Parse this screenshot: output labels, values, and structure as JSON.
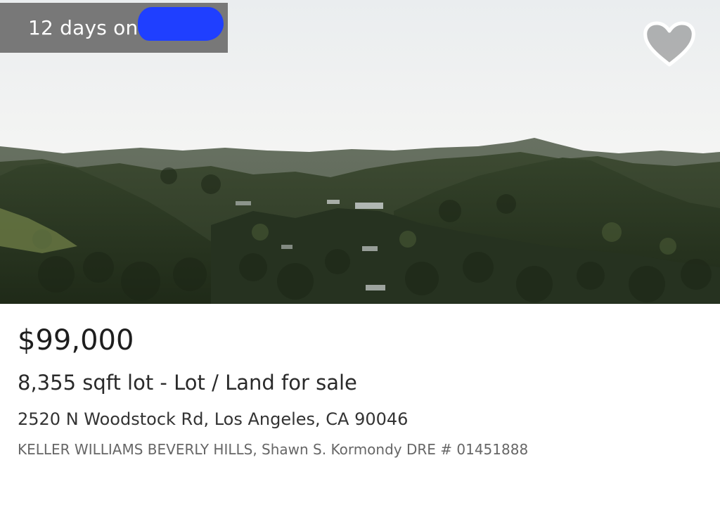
{
  "listing": {
    "days_on_market": "12 days on",
    "price": "$99,000",
    "lot_size": "8,355 sqft lot",
    "separator": " - ",
    "listing_type": "Lot / Land for sale",
    "address": "2520 N Woodstock Rd, Los Angeles, CA 90046",
    "broker": "KELLER WILLIAMS BEVERLY HILLS, Shawn S. Kormondy DRE # 01451888"
  },
  "icons": {
    "favorite": "heart-icon",
    "redaction": "redacted-site-name"
  },
  "colors": {
    "badge_background": "#6e6e6e",
    "badge_text": "#ffffff",
    "redaction": "#1f3fff",
    "price_text": "#1e1e1e",
    "broker_text": "#666666"
  }
}
